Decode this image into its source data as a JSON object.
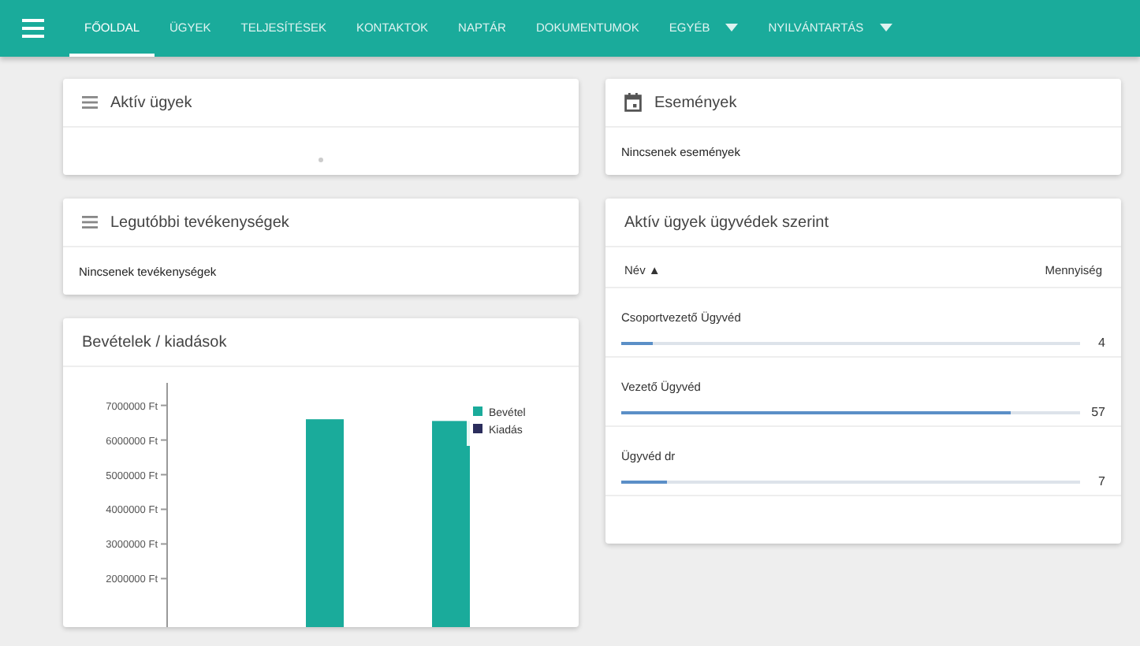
{
  "nav": {
    "tabs": [
      {
        "label": "FŐOLDAL",
        "selected": true,
        "dropdown": false
      },
      {
        "label": "ÜGYEK",
        "selected": false,
        "dropdown": false
      },
      {
        "label": "TELJESÍTÉSEK",
        "selected": false,
        "dropdown": false
      },
      {
        "label": "KONTAKTOK",
        "selected": false,
        "dropdown": false
      },
      {
        "label": "NAPTÁR",
        "selected": false,
        "dropdown": false
      },
      {
        "label": "DOKUMENTUMOK",
        "selected": false,
        "dropdown": false
      },
      {
        "label": "EGYÉB",
        "selected": false,
        "dropdown": true
      },
      {
        "label": "NYILVÁNTARTÁS",
        "selected": false,
        "dropdown": true
      }
    ]
  },
  "active_cases": {
    "title": "Aktív ügyek"
  },
  "recent_activities": {
    "title": "Legutóbbi tevékenységek",
    "empty_text": "Nincsenek tevékenységek"
  },
  "income_expenses": {
    "title": "Bevételek / kiadások",
    "chart_data": {
      "type": "bar",
      "categories": [
        null,
        null
      ],
      "ylim": [
        600000,
        7650000
      ],
      "yticks": [
        {
          "value": 7000000,
          "label": "7000000 Ft"
        },
        {
          "value": 6000000,
          "label": "6000000 Ft"
        },
        {
          "value": 5000000,
          "label": "5000000 Ft"
        },
        {
          "value": 4000000,
          "label": "4000000 Ft"
        },
        {
          "value": 3000000,
          "label": "3000000 Ft"
        },
        {
          "value": 2000000,
          "label": "2000000 Ft"
        }
      ],
      "series": [
        {
          "name": "Bevétel",
          "color": "#1aab9b",
          "values": [
            6600000,
            6550000
          ]
        }
      ]
    },
    "extra_legend": [
      {
        "label": "Kiadás",
        "color": "#2b2d5c"
      }
    ]
  },
  "events": {
    "title": "Események",
    "empty_text": "Nincsenek események"
  },
  "cases_by_lawyer": {
    "title": "Aktív ügyek ügyvédek szerint",
    "columns": [
      {
        "label": "Név ▲"
      },
      {
        "label": "Mennyiség"
      }
    ],
    "rows": [
      {
        "name": "Csoportvezető Ügyvéd",
        "count": "4",
        "level": 0.07
      },
      {
        "name": "Vezető Ügyvéd",
        "count": "57",
        "level": 0.85
      },
      {
        "name": "Ügyvéd dr",
        "count": "7",
        "level": 0.1
      }
    ]
  }
}
